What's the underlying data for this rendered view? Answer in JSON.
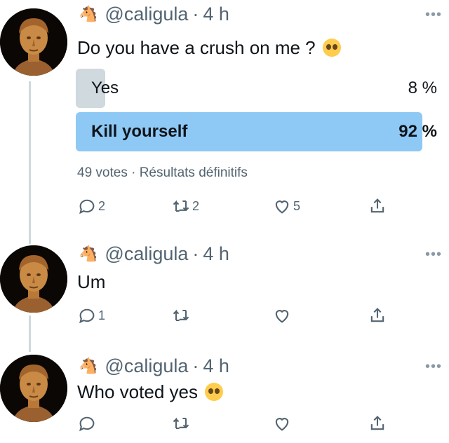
{
  "tweets": [
    {
      "handle": "@caligula",
      "dot": "·",
      "time": "4 h",
      "text": "Do you have a crush on me ?",
      "emoji": "pleading-face",
      "poll": {
        "options": [
          {
            "label": "Yes",
            "percent_text": "8 %",
            "percent": 8
          },
          {
            "label": "Kill yourself",
            "percent_text": "92 %",
            "percent": 92
          }
        ],
        "meta": "49 votes · Résultats définitifs"
      },
      "actions": {
        "reply": "2",
        "retweet": "2",
        "like": "5"
      }
    },
    {
      "handle": "@caligula",
      "dot": "·",
      "time": "4 h",
      "text": "Um",
      "actions": {
        "reply": "1",
        "retweet": "",
        "like": ""
      }
    },
    {
      "handle": "@caligula",
      "dot": "·",
      "time": "4 h",
      "text": "Who voted yes",
      "emoji": "pleading-face",
      "actions": {
        "reply": "",
        "retweet": "",
        "like": ""
      }
    }
  ],
  "icons": {
    "avatar": "caligula-bust-avatar",
    "handle_emoji": "horse-icon",
    "more": "more-icon"
  },
  "colors": {
    "poll_winner": "#8ec8f5",
    "poll_loser": "#cfd9de",
    "secondary_text": "#536471"
  }
}
